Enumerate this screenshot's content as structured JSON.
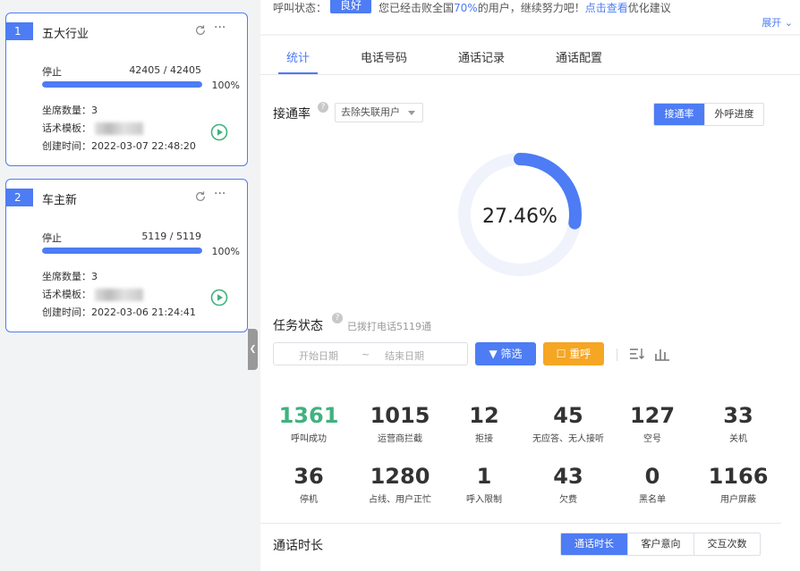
{
  "tasks": [
    {
      "index": "1",
      "name": "五大行业",
      "status": "停止",
      "count": "42405 / 42405",
      "progress": 100,
      "percent": "100%",
      "seats_label": "坐席数量：",
      "seats": "3",
      "template_label": "话术模板：",
      "created_label": "创建时间：",
      "created": "2022-03-07 22:48:20"
    },
    {
      "index": "2",
      "name": "车主新",
      "status": "停止",
      "count": "5119 / 5119",
      "progress": 100,
      "percent": "100%",
      "seats_label": "坐席数量：",
      "seats": "3",
      "template_label": "话术模板：",
      "created_label": "创建时间：",
      "created": "2022-03-06 21:24:41"
    }
  ],
  "topbar": {
    "label": "呼叫状态：",
    "badge": "良好",
    "msg_prefix": "您已经击败全国",
    "msg_pct": "70%",
    "msg_mid": "的用户，继续努力吧！",
    "msg_link": "点击查看",
    "msg_suffix": "优化建议",
    "expand": "展开"
  },
  "tabs": [
    "统计",
    "电话号码",
    "通话记录",
    "通话配置"
  ],
  "connect": {
    "title": "接通率",
    "select": "去除失联用户",
    "seg": [
      "接通率",
      "外呼进度"
    ],
    "rate": "27.46%",
    "rate_value": 27.46
  },
  "task_status": {
    "title": "任务状态",
    "dials": "已拨打电话5119通",
    "start_placeholder": "开始日期",
    "tilde": "~",
    "end_placeholder": "结束日期",
    "filter": "筛选",
    "reset": "重呼"
  },
  "stats": [
    {
      "num": "1361",
      "cap": "呼叫成功"
    },
    {
      "num": "1015",
      "cap": "运营商拦截"
    },
    {
      "num": "12",
      "cap": "拒接"
    },
    {
      "num": "45",
      "cap": "无应答、无人接听"
    },
    {
      "num": "127",
      "cap": "空号"
    },
    {
      "num": "33",
      "cap": "关机"
    },
    {
      "num": "36",
      "cap": "停机"
    },
    {
      "num": "1280",
      "cap": "占线、用户正忙"
    },
    {
      "num": "1",
      "cap": "呼入限制"
    },
    {
      "num": "43",
      "cap": "欠费"
    },
    {
      "num": "0",
      "cap": "黑名单"
    },
    {
      "num": "1166",
      "cap": "用户屏蔽"
    }
  ],
  "duration": {
    "title": "通话时长",
    "seg": [
      "通话时长",
      "客户意向",
      "交互次数"
    ]
  },
  "colors": {
    "accent": "#4d7cf4",
    "success": "#3fb27f",
    "warning": "#f5a623"
  }
}
